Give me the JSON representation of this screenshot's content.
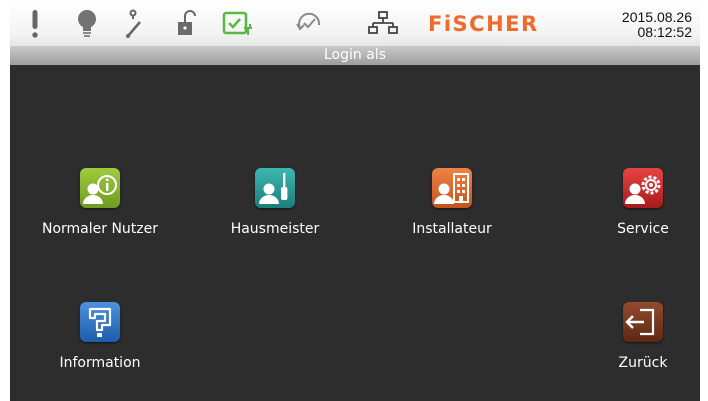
{
  "statusbar": {
    "icons": [
      "alarm-icon",
      "lamp-icon",
      "switch-icon",
      "lock-open-icon",
      "power-ok-icon",
      "sync-check-icon",
      "network-icon"
    ],
    "brand": "FiSCHER",
    "date": "2015.08.26",
    "time": "08:12:52"
  },
  "title": "Login als",
  "tiles": [
    {
      "label": "Normaler Nutzer",
      "icon": "user-info-icon",
      "color": "#7fae2a"
    },
    {
      "label": "Hausmeister",
      "icon": "user-screwdriver-icon",
      "color": "#23928f"
    },
    {
      "label": "Installateur",
      "icon": "user-building-icon",
      "color": "#d9662a"
    },
    {
      "label": "Service",
      "icon": "user-gear-icon",
      "color": "#c82626"
    },
    {
      "label": "Information",
      "icon": "help-icon",
      "color": "#2c6fc2"
    },
    {
      "label": "Zurück",
      "icon": "exit-door-icon",
      "color": "#7a3a22"
    }
  ],
  "colors": {
    "accent": "#f06a2c",
    "background": "#2d2d2d",
    "titlebar": "#b0b0b0"
  }
}
